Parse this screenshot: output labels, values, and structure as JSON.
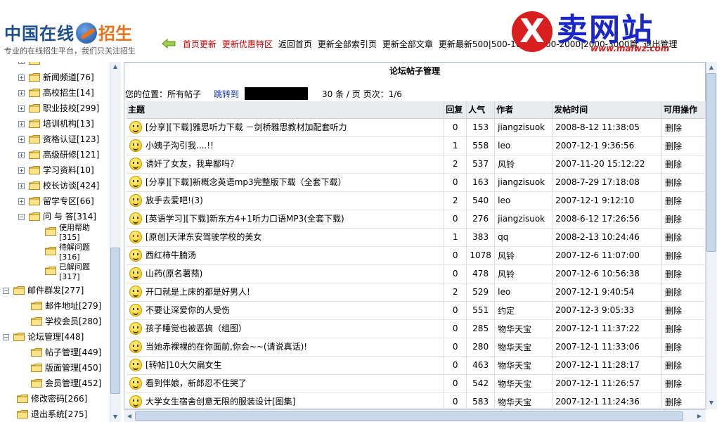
{
  "header": {
    "logo_text": "中国在线",
    "logo_highlight": "招生",
    "slogan": "专业的在线招生平台，我们只关注招生",
    "nav": [
      {
        "label": "首页更新",
        "red": true
      },
      {
        "label": "更新优惠特区",
        "red": true
      },
      {
        "label": "返回首页",
        "red": false
      },
      {
        "label": "更新全部索引页",
        "red": false
      },
      {
        "label": "更新全部文章",
        "red": false
      },
      {
        "label": "更新最新500|500-1000|1000-2000|2000-3000篇",
        "red": false
      },
      {
        "label": "退出管理",
        "red": false
      }
    ],
    "brand": {
      "mark": "X",
      "text": "卖网站",
      "url": "www.maiwz.com"
    }
  },
  "sidebar": {
    "items": [
      {
        "label": "新闻频道[76]"
      },
      {
        "label": "高校招生[14]"
      },
      {
        "label": "职业技校[299]"
      },
      {
        "label": "培训机构[13]"
      },
      {
        "label": "资格认证[123]"
      },
      {
        "label": "高级研修[121]"
      },
      {
        "label": "学习资料[10]"
      },
      {
        "label": "校长访谈[424]"
      },
      {
        "label": "留学专区[66]"
      },
      {
        "label": "问 与 答[314]"
      }
    ],
    "qa_children": [
      {
        "line1": "使用帮助",
        "line2": "[315]"
      },
      {
        "line1": "待解问题",
        "line2": "[316]"
      },
      {
        "line1": "已解问题",
        "line2": "[317]"
      }
    ],
    "mail": {
      "label": "邮件群发[277]",
      "children": [
        "邮件地址[279]",
        "学校会员[280]"
      ]
    },
    "forum": {
      "label": "论坛管理[448]",
      "children": [
        "帖子管理[449]",
        "版面管理[450]",
        "会员管理[452]"
      ]
    },
    "extra": [
      "修改密码[266]",
      "退出系统[275]"
    ]
  },
  "main": {
    "title": "论坛帖子管理",
    "location": "您的位置：所有帖子",
    "jump_label": "跳转到",
    "per_page": "30 条 / 页",
    "page_info": "页次：1/6",
    "columns": [
      "主题",
      "回复",
      "人气",
      "作者",
      "发帖时间",
      "可用操作"
    ],
    "rows": [
      {
        "icon": "smile",
        "title": "[分享][下载]雅思听力下载 －剑桥雅思教材加配套听力",
        "replies": "0",
        "views": "153",
        "author": "jiangzisuok",
        "time": "2008-8-12 11:38:05",
        "action": "删除"
      },
      {
        "icon": "smile",
        "title": "小姨子沟引我....!!",
        "replies": "1",
        "views": "558",
        "author": "leo",
        "time": "2007-12-1 9:36:56",
        "action": "删除"
      },
      {
        "icon": "smile",
        "title": "诱奸了女友，我卑鄙吗？",
        "replies": "2",
        "views": "537",
        "author": "风铃",
        "time": "2007-11-20 15:12:22",
        "action": "删除"
      },
      {
        "icon": "smile",
        "title": "[分享][下载]新概念英语mp3完整版下载（全套下载）",
        "replies": "0",
        "views": "163",
        "author": "jiangzisuok",
        "time": "2008-7-29 17:18:08",
        "action": "删除"
      },
      {
        "icon": "smile",
        "title": "放手去爱吧!(3)",
        "replies": "2",
        "views": "540",
        "author": "leo",
        "time": "2007-12-1 9:12:10",
        "action": "删除"
      },
      {
        "icon": "smile",
        "title": "[英语学习][下载]新东方4+1听力口语MP3(全套下载)",
        "replies": "0",
        "views": "276",
        "author": "jiangzisuok",
        "time": "2008-6-12 17:26:56",
        "action": "删除"
      },
      {
        "icon": "love",
        "title": "[原创]天津东安驾驶学校的美女",
        "replies": "1",
        "views": "383",
        "author": "qq",
        "time": "2008-2-13 10:24:46",
        "action": "删除"
      },
      {
        "icon": "smile",
        "title": "西红柿牛腩汤",
        "replies": "0",
        "views": "1078",
        "author": "风铃",
        "time": "2007-12-6 11:07:00",
        "action": "删除"
      },
      {
        "icon": "smile",
        "title": "山药(原名薯蓣)",
        "replies": "0",
        "views": "478",
        "author": "风铃",
        "time": "2007-12-6 10:56:38",
        "action": "删除"
      },
      {
        "icon": "smile",
        "title": "开口就是上床的都是好男人!",
        "replies": "2",
        "views": "529",
        "author": "leo",
        "time": "2007-12-1 9:40:54",
        "action": "删除"
      },
      {
        "icon": "smile",
        "title": "不要让深爱你的人受伤",
        "replies": "0",
        "views": "551",
        "author": "约定",
        "time": "2007-12-3 9:05:33",
        "action": "删除"
      },
      {
        "icon": "smile",
        "title": "孩子睡觉也被恶搞（组图）",
        "replies": "0",
        "views": "285",
        "author": "物华天宝",
        "time": "2007-12-1 11:37:22",
        "action": "删除"
      },
      {
        "icon": "smile",
        "title": "当她赤裸裸的在你面前,你会~~(请说真话)!",
        "replies": "0",
        "views": "280",
        "author": "物华天宝",
        "time": "2007-12-1 11:33:06",
        "action": "删除"
      },
      {
        "icon": "smile",
        "title": "[转帖]10大欠扁女生",
        "replies": "0",
        "views": "463",
        "author": "物华天宝",
        "time": "2007-12-1 11:28:17",
        "action": "删除"
      },
      {
        "icon": "smile",
        "title": "看到伴娘，新郎忍不住哭了",
        "replies": "0",
        "views": "542",
        "author": "物华天宝",
        "time": "2007-12-1 11:26:57",
        "action": "删除"
      },
      {
        "icon": "smile",
        "title": "大学女生宿舍创意无限的服装设计[图集]",
        "replies": "0",
        "views": "583",
        "author": "物华天宝",
        "time": "2007-12-1 11:24:36",
        "action": "删除"
      }
    ]
  }
}
